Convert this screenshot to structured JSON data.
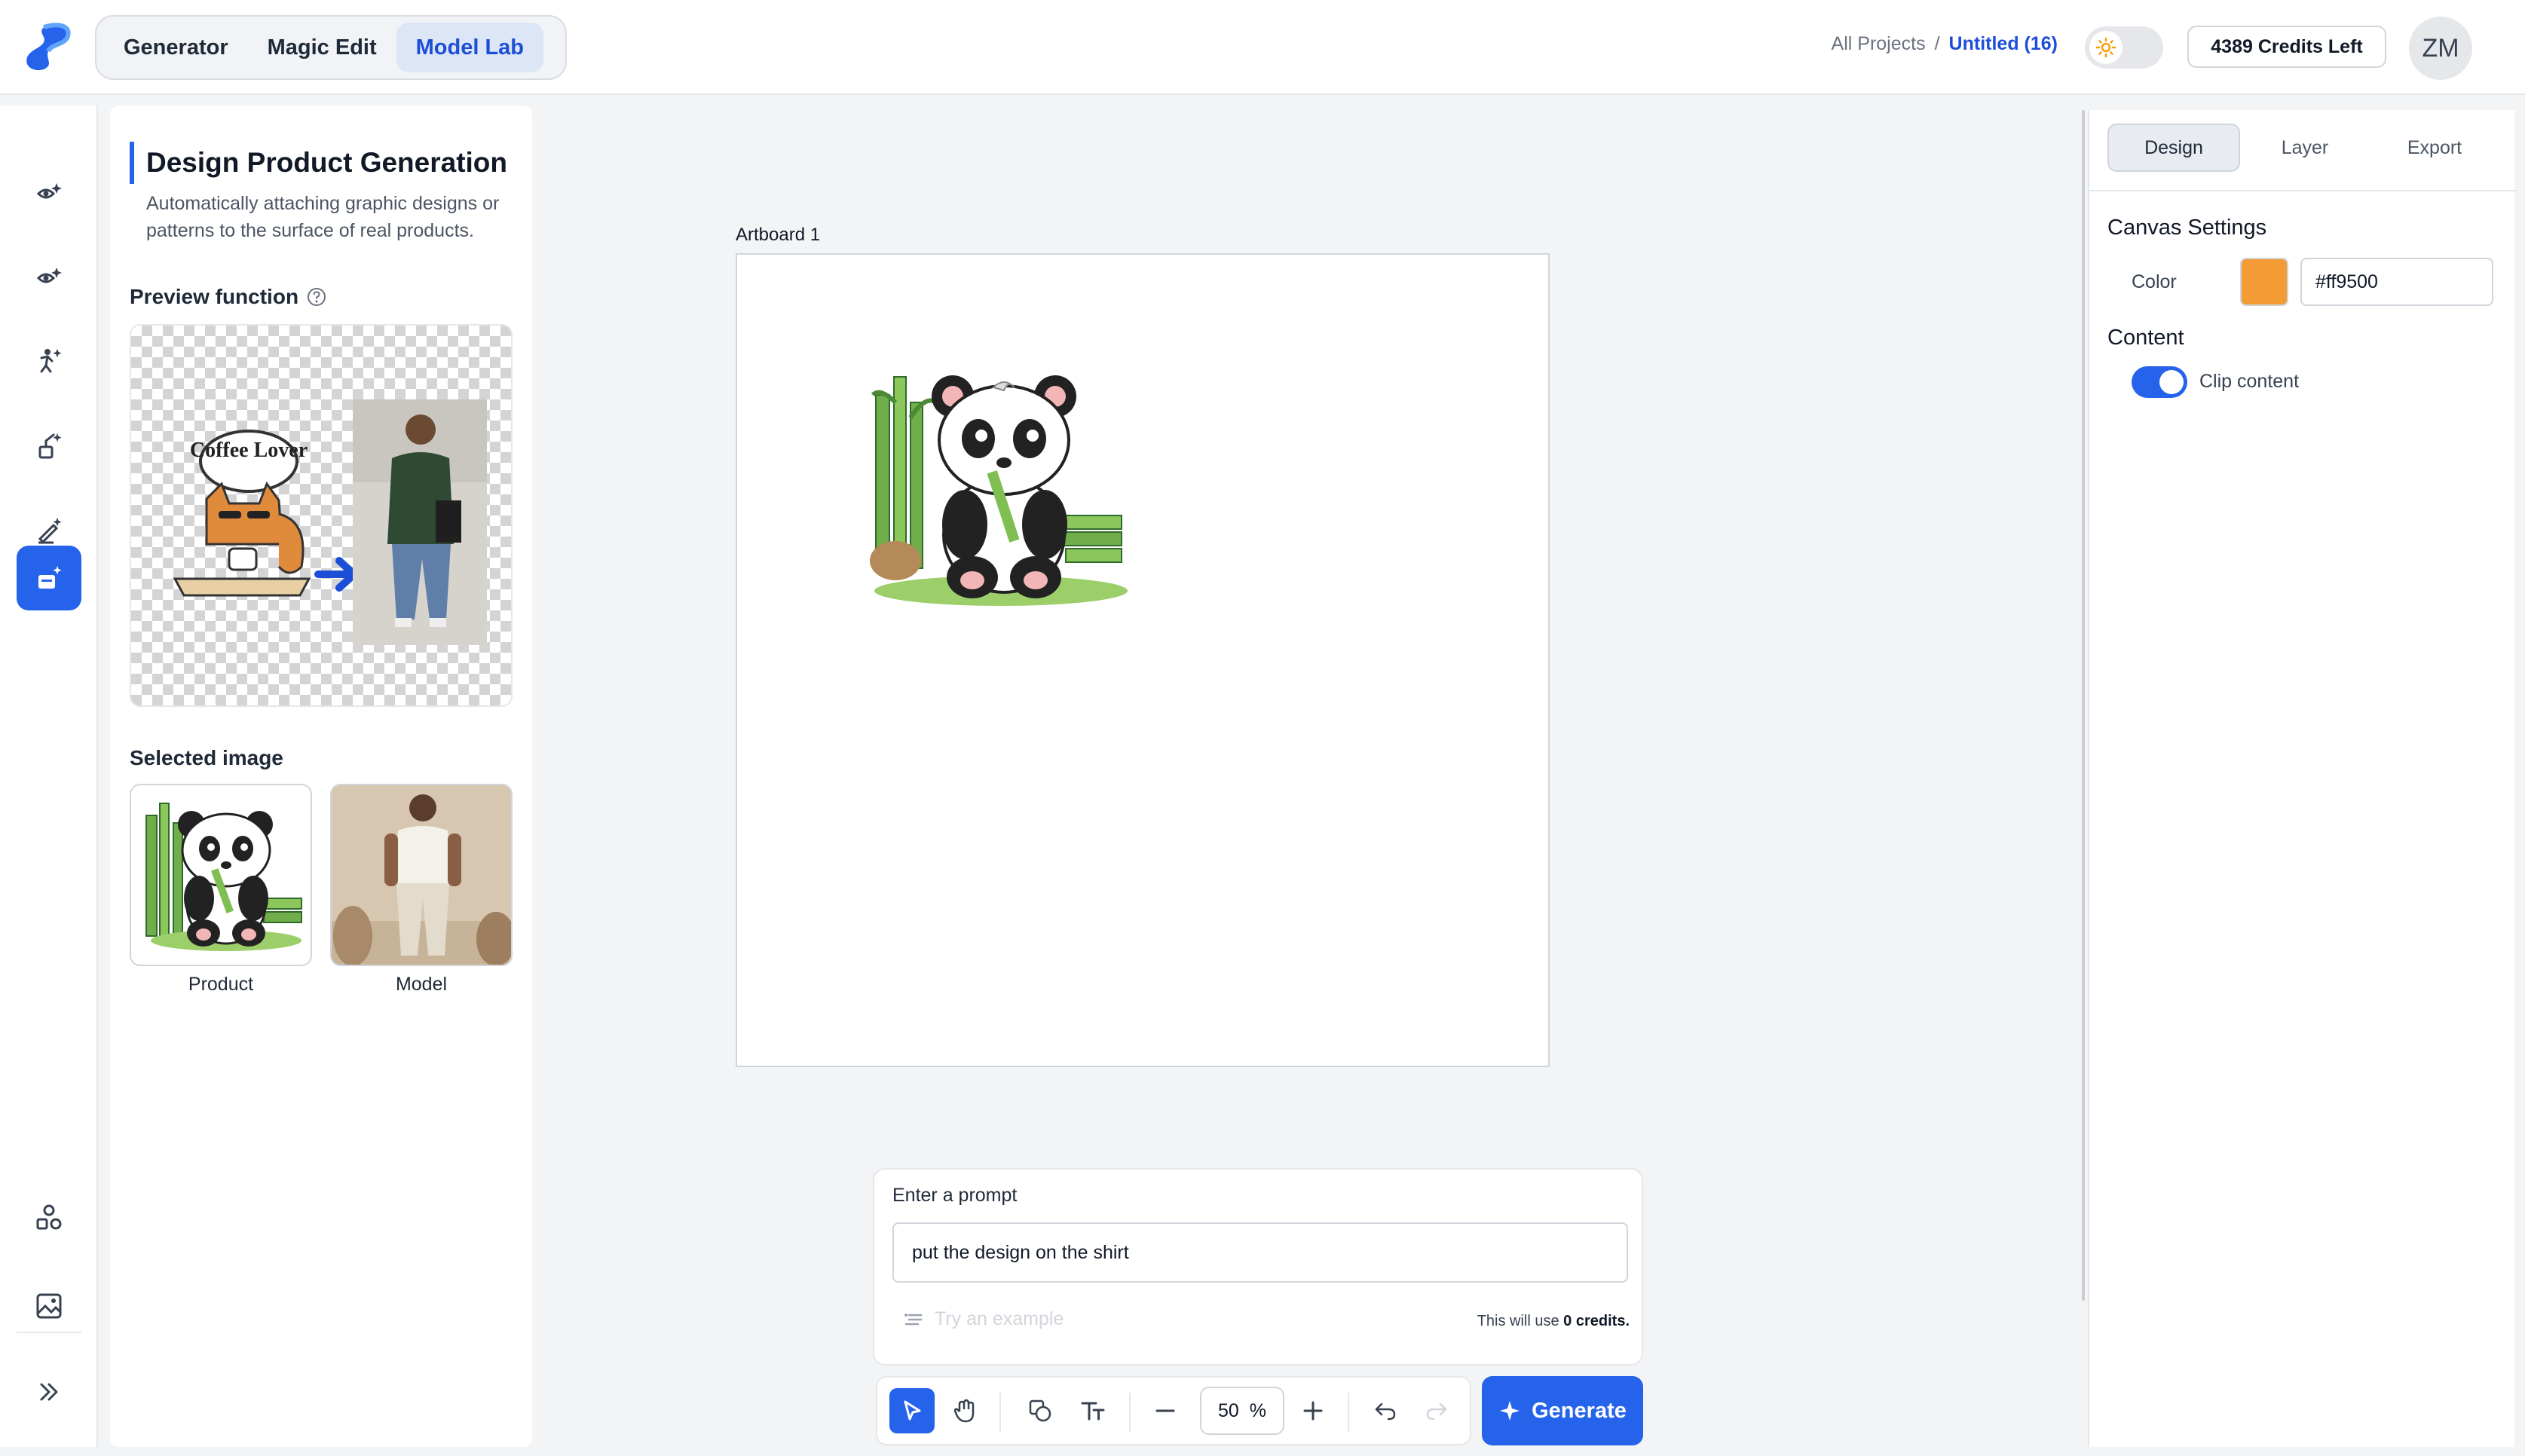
{
  "nav": {
    "modes": [
      "Generator",
      "Magic Edit",
      "Model Lab"
    ],
    "active_mode": "Model Lab",
    "breadcrumb_root": "All Projects",
    "breadcrumb_sep": "/",
    "breadcrumb_current": "Untitled (16)",
    "credits": "4389 Credits Left",
    "avatar": "ZM"
  },
  "rail": {
    "items": [
      "eye-sparkle-icon",
      "eye-sparkle-icon",
      "figure-sparkle-icon",
      "brush-sparkle-icon",
      "pen-sparkle-icon",
      "product-sparkle-icon"
    ],
    "active_index": 5,
    "bottom": [
      "shapes-icon",
      "image-icon",
      "expand-icon"
    ]
  },
  "panel": {
    "title": "Design Product Generation",
    "description": "Automatically attaching graphic designs or patterns to the surface of real products.",
    "preview_label": "Preview function",
    "preview_text": "Coffee Lover",
    "selected_label": "Selected image",
    "product_label": "Product",
    "model_label": "Model"
  },
  "canvas": {
    "artboard_label": "Artboard 1"
  },
  "prompt": {
    "label": "Enter a prompt",
    "value": "put the design on the shirt",
    "example_placeholder": "Try an example",
    "credits_prefix": "This will use",
    "credits_value": "0 credits."
  },
  "toolbar": {
    "zoom_value": "50",
    "zoom_unit": "%",
    "generate_label": "Generate"
  },
  "right": {
    "tabs": [
      "Design",
      "Layer",
      "Export"
    ],
    "active_tab": "Design",
    "canvas_settings": "Canvas Settings",
    "color_label": "Color",
    "color_value": "#ff9500",
    "swatch_color": "#f39b35",
    "content_label": "Content",
    "clip_label": "Clip content",
    "clip_on": true
  },
  "colors": {
    "accent": "#2563eb"
  }
}
